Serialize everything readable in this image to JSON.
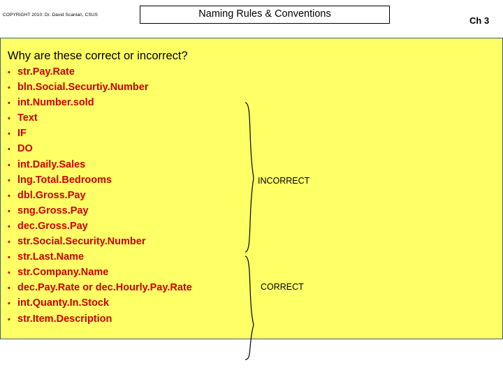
{
  "header": {
    "copyright": "COPYRIGHT 2010: Dr. David Scanlan, CSUS",
    "title": "Naming Rules & Conventions",
    "chapter": "Ch 3"
  },
  "body": {
    "question": "Why are these correct or incorrect?",
    "items": [
      "str.Pay.Rate",
      "bln.Social.Securtiy.Number",
      "int.Number.sold",
      "Text",
      "IF",
      "DO",
      "int.Daily.Sales",
      "lng.Total.Bedrooms",
      "dbl.Gross.Pay",
      "sng.Gross.Pay",
      "dec.Gross.Pay",
      "str.Social.Security.Number",
      "str.Last.Name",
      "str.Company.Name",
      "dec.Pay.Rate or dec.Hourly.Pay.Rate",
      "int.Quanty.In.Stock",
      "str.Item.Description"
    ],
    "bullet_glyph": "•",
    "brace_labels": {
      "incorrect": "INCORRECT",
      "correct": "CORRECT"
    }
  },
  "colors": {
    "panel_background": "#ffff66",
    "panel_border": "#3b5f8f",
    "item_text": "#cc0000",
    "page_background": "#ffffff",
    "text": "#000000"
  }
}
